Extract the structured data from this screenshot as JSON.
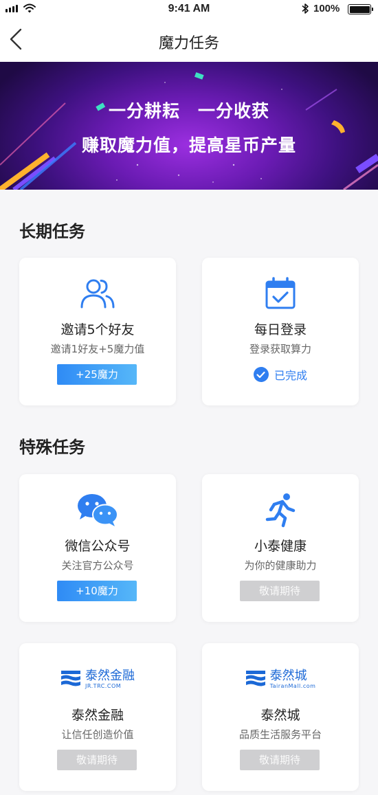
{
  "status_bar": {
    "time": "9:41 AM",
    "battery_text": "100%",
    "battery_level": 1.0,
    "icons": [
      "signal-icon",
      "wifi-icon",
      "bluetooth-icon",
      "battery-icon"
    ]
  },
  "nav": {
    "title": "魔力任务",
    "back_icon": "chevron-left-icon"
  },
  "banner": {
    "line1": "一分耕耘　一分收获",
    "line2": "赚取魔力值，提高星币产量"
  },
  "sections": [
    {
      "title": "长期任务",
      "cards": [
        {
          "name": "邀请5个好友",
          "desc": "邀请1好友+5魔力值",
          "badge": "+25魔力",
          "badge_type": "reward",
          "icon": "users-icon"
        },
        {
          "name": "每日登录",
          "desc": "登录获取算力",
          "badge": "已完成",
          "badge_type": "done",
          "icon": "calendar-check-icon"
        }
      ]
    },
    {
      "title": "特殊任务",
      "cards": [
        {
          "name": "微信公众号",
          "desc": "关注官方公众号",
          "badge": "+10魔力",
          "badge_type": "reward",
          "icon": "wechat-icon"
        },
        {
          "name": "小泰健康",
          "desc": "为你的健康助力",
          "badge": "敬请期待",
          "badge_type": "pending",
          "icon": "runner-icon"
        },
        {
          "name": "泰然金融",
          "desc": "让信任创造价值",
          "badge": "敬请期待",
          "badge_type": "pending",
          "icon": "tairan-finance-logo",
          "logo_big": "泰然金融",
          "logo_small": "JR.TRC.COM"
        },
        {
          "name": "泰然城",
          "desc": "品质生活服务平台",
          "badge": "敬请期待",
          "badge_type": "pending",
          "icon": "tairan-city-logo",
          "logo_big": "泰然城",
          "logo_small": "TairanMall.com"
        }
      ]
    }
  ],
  "colors": {
    "accent": "#2f7ef0",
    "reward_gradient_start": "#2f8bf5",
    "reward_gradient_end": "#56b7f8",
    "pending": "#cfcfd1",
    "banner_center": "#9b2fe0",
    "banner_edge": "#1f0a45",
    "page_bg": "#f6f6f8"
  }
}
